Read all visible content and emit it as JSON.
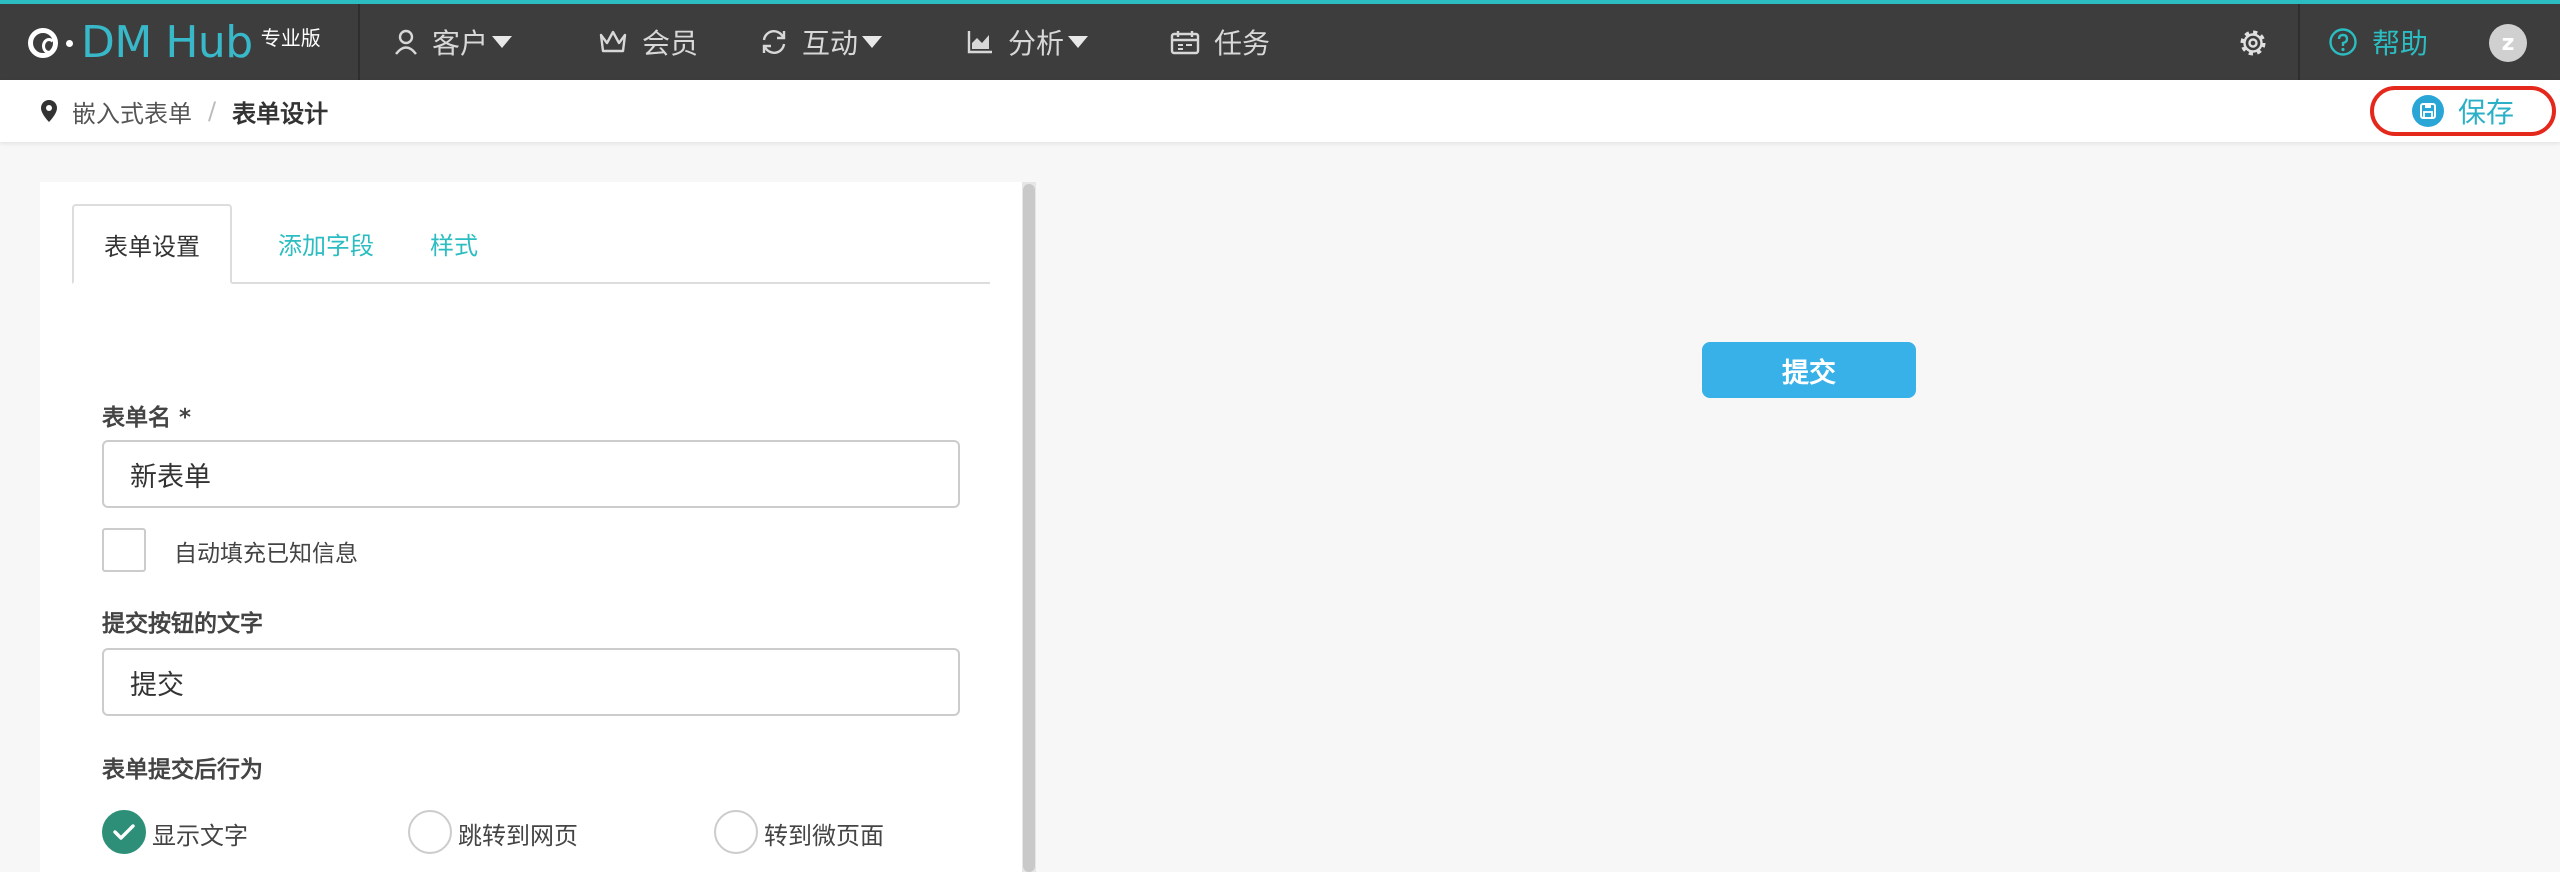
{
  "brand": {
    "name": "DM Hub",
    "edition": "专业版",
    "accent": "#2bbdc1"
  },
  "nav": {
    "items": [
      {
        "label": "客户",
        "icon": "user-icon",
        "dropdown": true
      },
      {
        "label": "会员",
        "icon": "crown-icon",
        "dropdown": false
      },
      {
        "label": "互动",
        "icon": "refresh-icon",
        "dropdown": true
      },
      {
        "label": "分析",
        "icon": "chart-icon",
        "dropdown": true
      },
      {
        "label": "任务",
        "icon": "calendar-icon",
        "dropdown": false
      }
    ],
    "help_label": "帮助",
    "avatar_initial": "z"
  },
  "breadcrumb": {
    "parent": "嵌入式表单",
    "separator": "/",
    "current": "表单设计"
  },
  "toolbar": {
    "save_label": "保存",
    "save_highlight_color": "#e5281c"
  },
  "tabs": [
    {
      "label": "表单设置",
      "active": true
    },
    {
      "label": "添加字段",
      "active": false
    },
    {
      "label": "样式",
      "active": false
    }
  ],
  "form": {
    "name_label": "表单名 *",
    "name_value": "新表单",
    "autofill_label": "自动填充已知信息",
    "autofill_checked": false,
    "submit_text_label": "提交按钮的文字",
    "submit_text_value": "提交",
    "after_submit_label": "表单提交后行为",
    "after_submit_options": [
      {
        "label": "显示文字",
        "selected": true
      },
      {
        "label": "跳转到网页",
        "selected": false
      },
      {
        "label": "转到微页面",
        "selected": false
      }
    ]
  },
  "preview": {
    "submit_button_label": "提交",
    "button_color": "#37b1e8"
  }
}
